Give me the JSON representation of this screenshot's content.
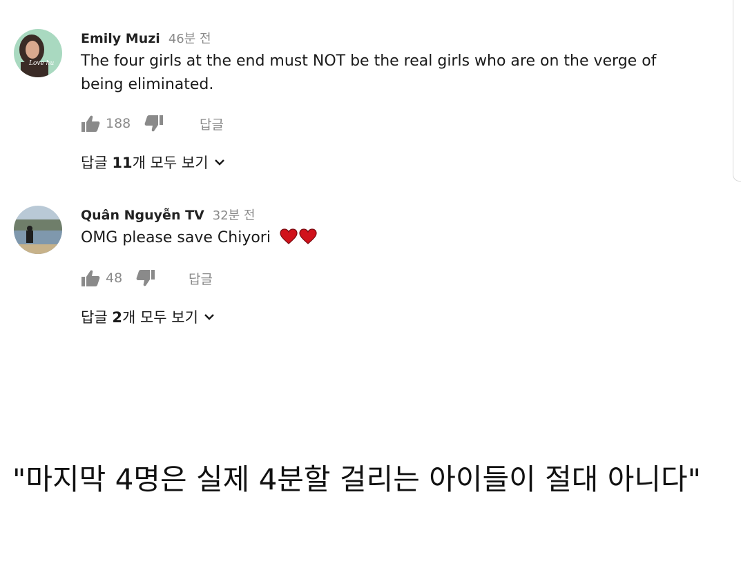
{
  "comments": [
    {
      "author": "Emily Muzi",
      "time": "46분 전",
      "text": "The four girls at the end must NOT be the real girls who are on the verge of being eliminated.",
      "likes": "188",
      "reply_label": "답글",
      "view_replies": {
        "prefix": "답글 ",
        "count": "11",
        "suffix": "개 모두 보기"
      },
      "avatar_text": "Love hu",
      "icons": [
        "thumb-up-icon",
        "thumb-down-icon",
        "chevron-down-icon"
      ]
    },
    {
      "author": "Quân Nguyễn TV",
      "time": "32분 전",
      "text": "OMG please save Chiyori",
      "likes": "48",
      "reply_label": "답글",
      "view_replies": {
        "prefix": "답글 ",
        "count": "2",
        "suffix": "개 모두 보기"
      },
      "icons": [
        "thumb-up-icon",
        "thumb-down-icon",
        "heart-icon",
        "chevron-down-icon"
      ]
    }
  ],
  "caption": "\"마지막 4명은 실제 4분할 걸리는 아이들이 절대 아니다\"",
  "colors": {
    "text": "#1a1a1a",
    "muted": "#8a8a8a",
    "heart": "#d0121b"
  }
}
